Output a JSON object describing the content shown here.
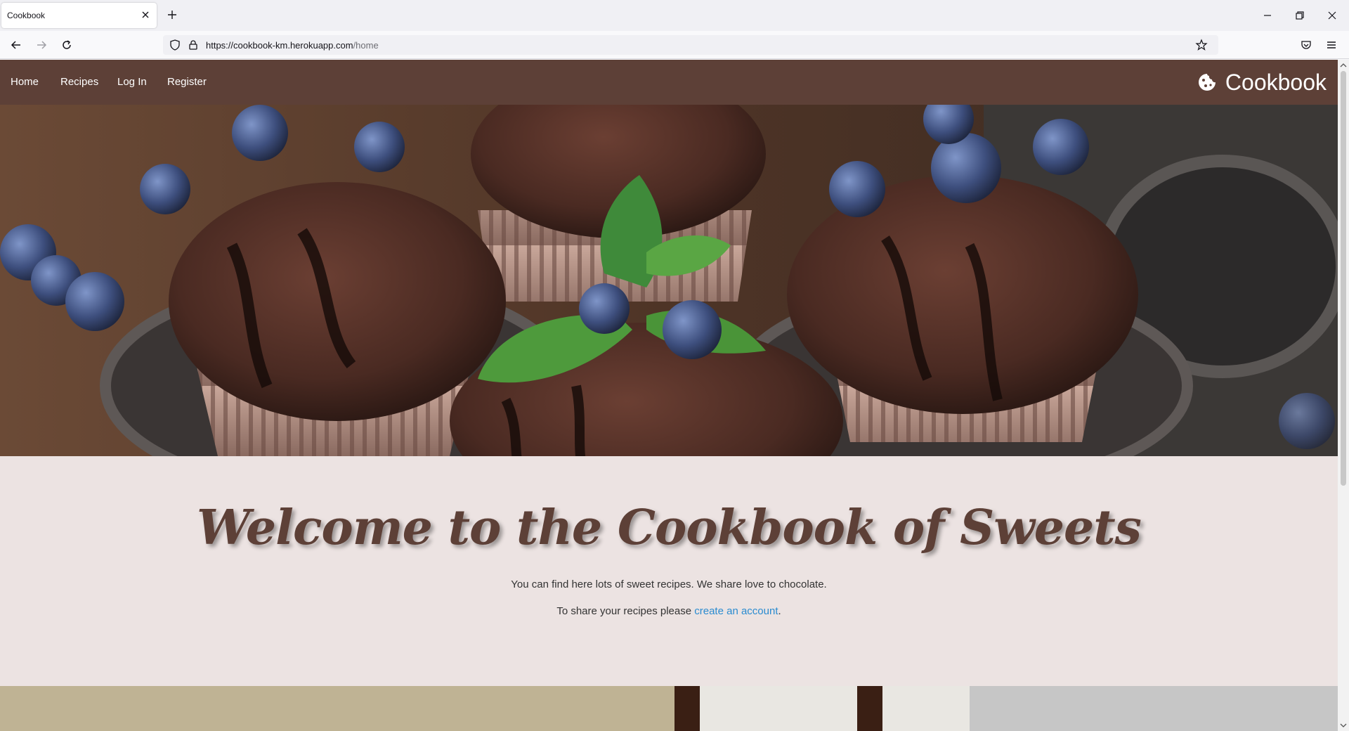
{
  "browser": {
    "tab_title": "Cookbook",
    "url_host": "https://cookbook-km.herokuapp.com",
    "url_path": "/home"
  },
  "site": {
    "nav": {
      "home": "Home",
      "recipes": "Recipes",
      "login": "Log In",
      "register": "Register",
      "brand": "Cookbook"
    },
    "welcome": {
      "heading": "Welcome to the Cookbook of Sweets",
      "line1": "You can find here lots of sweet recipes. We share love to chocolate.",
      "line2_prefix": "To share your recipes please ",
      "line2_link": "create an account",
      "line2_suffix": "."
    }
  },
  "colors": {
    "nav_bg": "#5d4037",
    "page_bg": "#ece3e2",
    "heading": "#5d4037",
    "link": "#2a8bd0"
  },
  "icons": [
    "close-icon",
    "plus-icon",
    "minimize-icon",
    "restore-icon",
    "back-icon",
    "forward-icon",
    "reload-icon",
    "shield-icon",
    "lock-icon",
    "star-icon",
    "pocket-icon",
    "menu-icon",
    "cookie-icon"
  ]
}
